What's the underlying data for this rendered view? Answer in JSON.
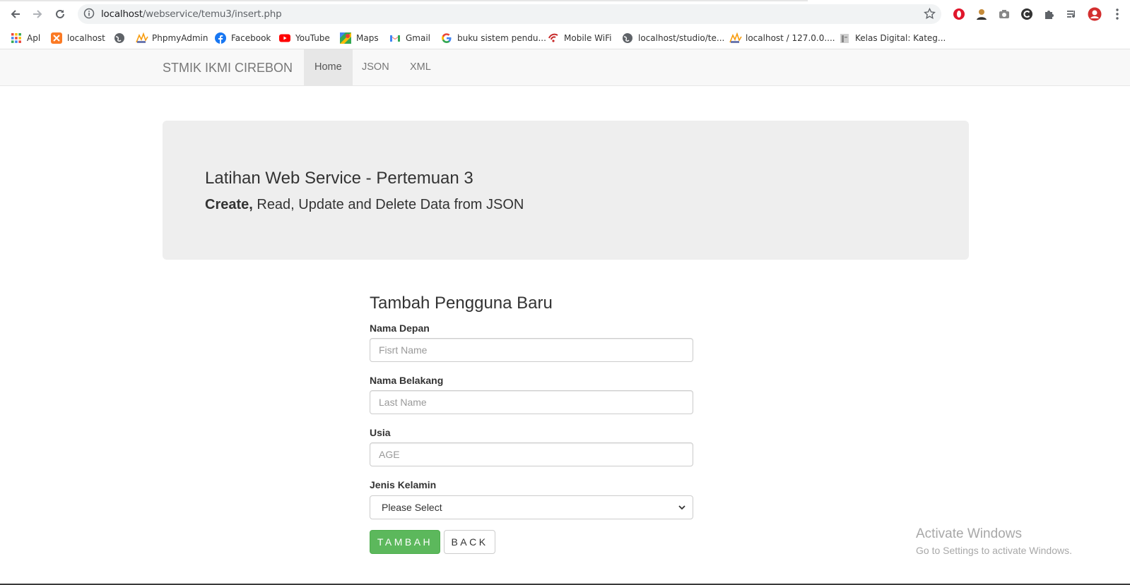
{
  "browser": {
    "url_host": "localhost",
    "url_path": "/webservice/temu3/insert.php",
    "bookmarks": [
      {
        "label": "Apl",
        "icon": "apps-grid-icon"
      },
      {
        "label": "localhost",
        "icon": "xampp-icon"
      },
      {
        "label": "",
        "icon": "globe-icon"
      },
      {
        "label": "PhpmyAdmin",
        "icon": "phpmyadmin-icon"
      },
      {
        "label": "Facebook",
        "icon": "facebook-icon"
      },
      {
        "label": "YouTube",
        "icon": "youtube-icon"
      },
      {
        "label": "Maps",
        "icon": "maps-icon"
      },
      {
        "label": "Gmail",
        "icon": "gmail-icon"
      },
      {
        "label": "buku sistem pendu...",
        "icon": "google-icon"
      },
      {
        "label": "Mobile WiFi",
        "icon": "wifi-router-icon"
      },
      {
        "label": "localhost/studio/te...",
        "icon": "globe-icon"
      },
      {
        "label": "localhost / 127.0.0....",
        "icon": "phpmyadmin-icon"
      },
      {
        "label": "Kelas Digital: Kateg...",
        "icon": "page-icon"
      }
    ]
  },
  "navbar": {
    "brand": "STMIK IKMI CIREBON",
    "links": [
      "Home",
      "JSON",
      "XML"
    ],
    "active": "Home"
  },
  "jumbotron": {
    "title": "Latihan Web Service - Pertemuan 3",
    "subtitle_bold": "Create,",
    "subtitle_rest": " Read, Update and Delete Data from JSON"
  },
  "form": {
    "title": "Tambah Pengguna Baru",
    "first_name_label": "Nama Depan",
    "first_name_placeholder": "Fisrt Name",
    "last_name_label": "Nama Belakang",
    "last_name_placeholder": "Last Name",
    "age_label": "Usia",
    "age_placeholder": "AGE",
    "gender_label": "Jenis Kelamin",
    "gender_selected": "Please Select",
    "submit_label": "TAMBAH",
    "back_label": "BACK"
  },
  "watermark": {
    "line1": "Activate Windows",
    "line2": "Go to Settings to activate Windows."
  },
  "colors": {
    "accent_green": "#5cb85c",
    "navbar_bg": "#f8f8f8",
    "jumbotron_bg": "#eeeeee"
  }
}
